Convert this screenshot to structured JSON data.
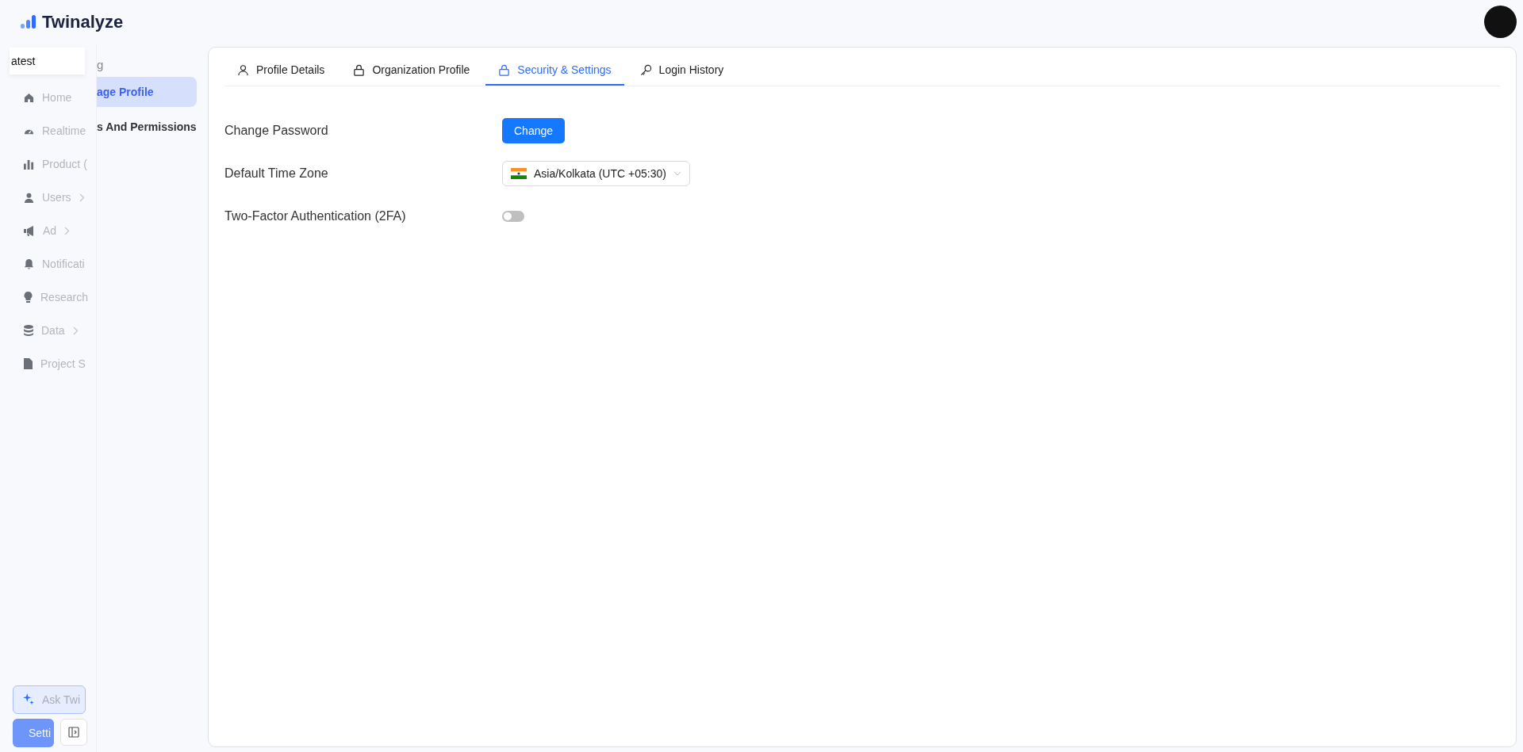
{
  "brand": {
    "name": "Twinalyze"
  },
  "settings_nav": {
    "heading": "g",
    "items": [
      {
        "label": "age Profile",
        "selected": true
      },
      {
        "label": "s And Permissions",
        "selected": false
      }
    ]
  },
  "side_menu": {
    "project": "atest",
    "items": [
      {
        "label": "Home",
        "has_submenu": false
      },
      {
        "label": "Realtime",
        "has_submenu": false
      },
      {
        "label": "Product (",
        "has_submenu": false
      },
      {
        "label": "Users",
        "has_submenu": true
      },
      {
        "label": "Ad",
        "has_submenu": true
      },
      {
        "label": "Notificati",
        "has_submenu": false
      },
      {
        "label": "Research",
        "has_submenu": false
      },
      {
        "label": "Data",
        "has_submenu": true
      },
      {
        "label": "Project S",
        "has_submenu": false
      }
    ],
    "ask_button": "Ask Twi",
    "settings_button": "Setti"
  },
  "tabs": [
    {
      "label": "Profile Details",
      "selected": false
    },
    {
      "label": "Organization Profile",
      "selected": false
    },
    {
      "label": "Security & Settings",
      "selected": true
    },
    {
      "label": "Login History",
      "selected": false
    }
  ],
  "form": {
    "rows": [
      {
        "label": "Change Password",
        "kind": "button",
        "value": "Change"
      },
      {
        "label": "Default Time Zone",
        "kind": "select",
        "value": "Asia/Kolkata (UTC +05:30)"
      },
      {
        "label": "Two-Factor Authentication (2FA)",
        "kind": "toggle",
        "on": false
      }
    ]
  }
}
